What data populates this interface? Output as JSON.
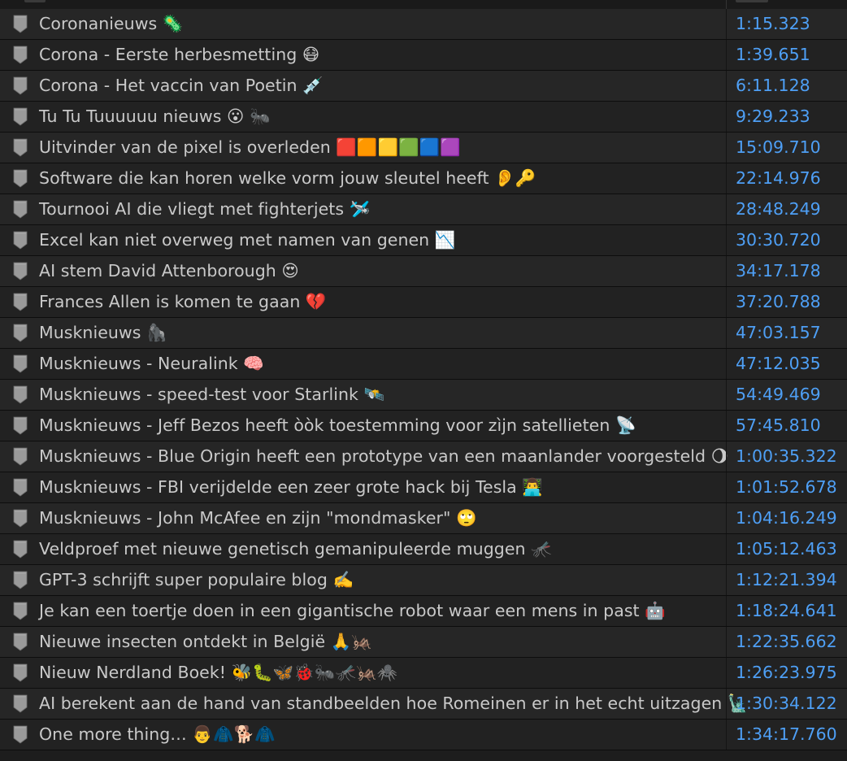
{
  "markers": [
    {
      "name": "Coronanieuws 🦠",
      "time": "1:15.323"
    },
    {
      "name": "Corona - Eerste herbesmetting 😷",
      "time": "1:39.651"
    },
    {
      "name": "Corona - Het vaccin van Poetin 💉",
      "time": "6:11.128"
    },
    {
      "name": "Tu Tu Tuuuuuu nieuws 😮 🐜",
      "time": "9:29.233"
    },
    {
      "name": "Uitvinder van de pixel is overleden 🟥🟧🟨🟩🟦🟪",
      "time": "15:09.710"
    },
    {
      "name": "Software die kan horen welke vorm jouw sleutel heeft 👂🔑",
      "time": "22:14.976"
    },
    {
      "name": "Tournooi AI die vliegt met fighterjets 🛩️",
      "time": "28:48.249"
    },
    {
      "name": "Excel kan niet overweg met namen van genen 📉",
      "time": "30:30.720"
    },
    {
      "name": "AI stem David Attenborough 😍",
      "time": "34:17.178"
    },
    {
      "name": "Frances Allen is komen te gaan 💔",
      "time": "37:20.788"
    },
    {
      "name": "Musknieuws 🦍",
      "time": "47:03.157"
    },
    {
      "name": "Musknieuws - Neuralink 🧠",
      "time": "47:12.035"
    },
    {
      "name": "Musknieuws - speed-test voor Starlink 🛰️",
      "time": "54:49.469"
    },
    {
      "name": "Musknieuws - Jeff Bezos heeft òòk toestemming voor zìjn satellieten 📡",
      "time": "57:45.810"
    },
    {
      "name": "Musknieuws - Blue Origin heeft een prototype van een maanlander voorgesteld 🌖",
      "time": "1:00:35.322"
    },
    {
      "name": "Musknieuws - FBI verijdelde een zeer grote hack bij Tesla 👨‍💻",
      "time": "1:01:52.678"
    },
    {
      "name": "Musknieuws - John McAfee en zijn \"mondmasker\" 🙄",
      "time": "1:04:16.249"
    },
    {
      "name": "Veldproef met nieuwe genetisch gemanipuleerde muggen 🦟",
      "time": "1:05:12.463"
    },
    {
      "name": "GPT-3 schrijft super populaire blog ✍️",
      "time": "1:12:21.394"
    },
    {
      "name": "Je kan een toertje doen in een gigantische robot waar een mens in past 🤖",
      "time": "1:18:24.641"
    },
    {
      "name": "Nieuwe insecten ontdekt in België 🙏🦗",
      "time": "1:22:35.662"
    },
    {
      "name": "Nieuw Nerdland Boek! 🐝🐛🦋🐞🐜🦟🦗🕷️",
      "time": "1:26:23.975"
    },
    {
      "name": "AI berekent aan de hand van standbeelden hoe Romeinen er in het echt uitzagen 🗽",
      "time": "1:30:34.122"
    },
    {
      "name": "One more thing… 👨🧥🐕🧥",
      "time": "1:34:17.760"
    }
  ],
  "colors": {
    "row_odd": "#262626",
    "row_even": "#222222",
    "name_text": "#c9c9c9",
    "time_text": "#4e9ff5",
    "marker_icon": "#9a9a9a"
  },
  "icons": {
    "marker": "marker-shield-icon"
  }
}
